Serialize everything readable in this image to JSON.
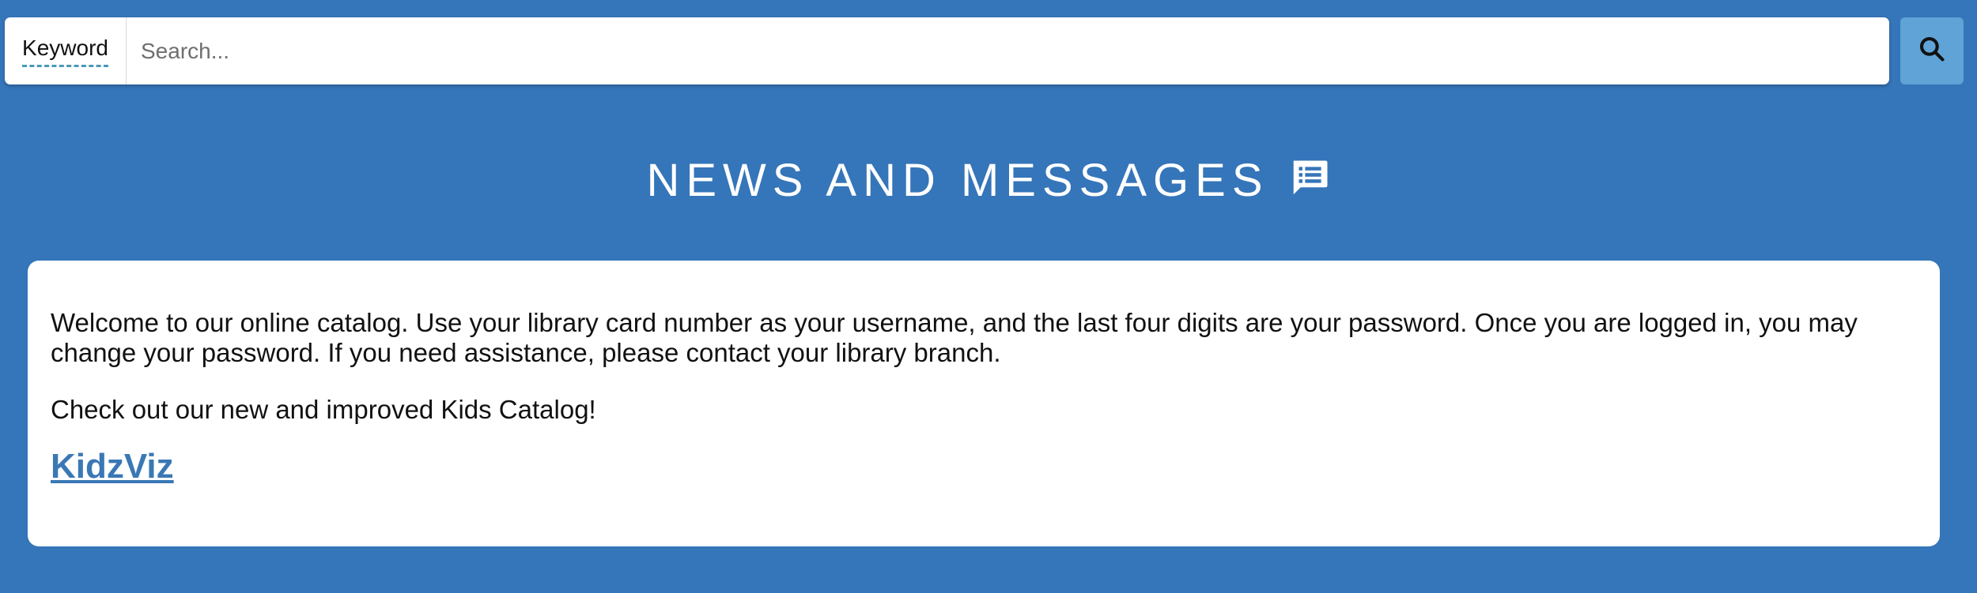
{
  "search": {
    "type_label": "Keyword",
    "placeholder": "Search...",
    "value": "",
    "button_icon": "search-icon"
  },
  "news": {
    "title": "NEWS AND MESSAGES",
    "title_icon": "message-list-icon",
    "paragraph_1": "Welcome to our online catalog. Use your library card number as your username, and the last four digits are your password. Once you are logged in, you may change your password. If you need assistance, please contact your library branch.",
    "paragraph_2": "Check out our new and improved Kids Catalog!",
    "link_label": "KidzViz"
  },
  "colors": {
    "page_background": "#3575b9",
    "search_button": "#5fa3d7",
    "link": "#3a78b5",
    "keyword_underline": "#4a98b8"
  }
}
